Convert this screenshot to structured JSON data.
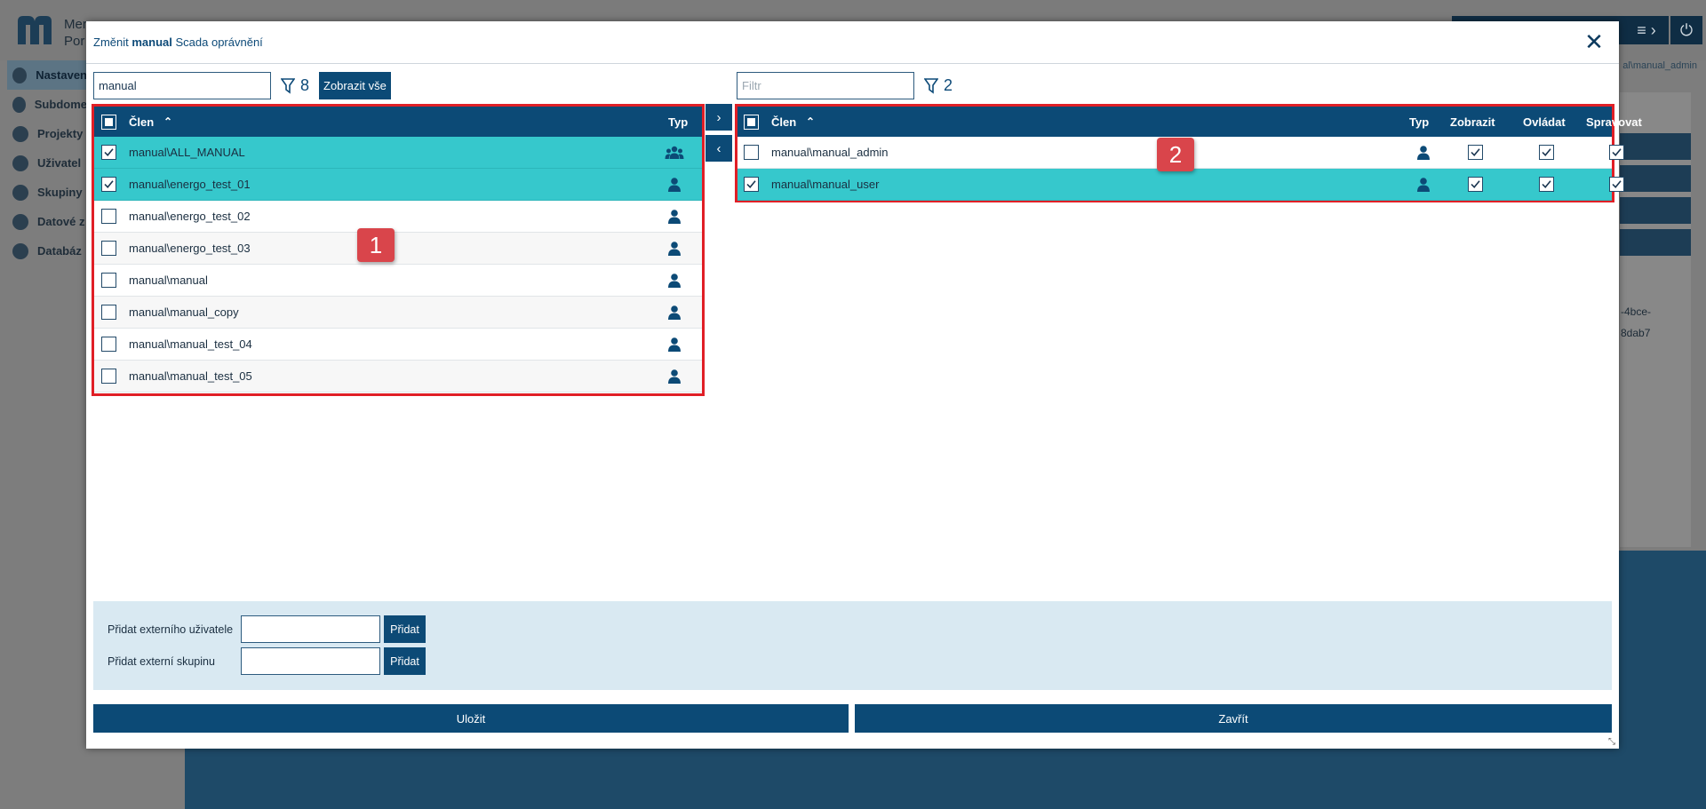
{
  "background": {
    "brand_line1": "Mer",
    "brand_line2": "Por",
    "user_label": "al\\manual_admin",
    "sidebar": [
      {
        "label": "Nastaven",
        "active": true
      },
      {
        "label": "Subdome"
      },
      {
        "label": "Projekty"
      },
      {
        "label": "Uživatel"
      },
      {
        "label": "Skupiny"
      },
      {
        "label": "Datové z"
      },
      {
        "label": "Databáz"
      }
    ],
    "snippet1": "-4bce-",
    "snippet2": "8dab7"
  },
  "dialog": {
    "title_prefix": "Změnit",
    "title_bold": "manual",
    "title_suffix": "Scada oprávnění",
    "close_label": "✕"
  },
  "left": {
    "search_value": "manual",
    "filter_count": "8",
    "show_all_label": "Zobrazit vše",
    "col_member": "Člen",
    "col_type": "Typ",
    "rows": [
      {
        "name": "manual\\ALL_MANUAL",
        "type": "group-icon",
        "checked": true
      },
      {
        "name": "manual\\energo_test_01",
        "type": "user-icon",
        "checked": true
      },
      {
        "name": "manual\\energo_test_02",
        "type": "user-icon",
        "checked": false
      },
      {
        "name": "manual\\energo_test_03",
        "type": "user-icon",
        "checked": false
      },
      {
        "name": "manual\\manual",
        "type": "user-icon",
        "checked": false
      },
      {
        "name": "manual\\manual_copy",
        "type": "user-icon",
        "checked": false
      },
      {
        "name": "manual\\manual_test_04",
        "type": "user-icon",
        "checked": false
      },
      {
        "name": "manual\\manual_test_05",
        "type": "user-icon",
        "checked": false
      }
    ],
    "badge": "1"
  },
  "right": {
    "search_placeholder": "Filtr",
    "filter_count": "2",
    "col_member": "Člen",
    "col_type": "Typ",
    "col_view": "Zobrazit",
    "col_control": "Ovládat",
    "col_manage": "Spravovat",
    "rows": [
      {
        "name": "manual\\manual_admin",
        "type": "user-icon",
        "checked": false,
        "view": true,
        "control": true,
        "manage": true
      },
      {
        "name": "manual\\manual_user",
        "type": "user-icon",
        "checked": true,
        "view": true,
        "control": true,
        "manage": true
      }
    ],
    "badge": "2"
  },
  "move": {
    "right_arrow": "›",
    "left_arrow": "‹"
  },
  "external": {
    "user_label": "Přidat externího uživatele",
    "group_label": "Přidat externí skupinu",
    "add_label": "Přidat"
  },
  "footer": {
    "save_label": "Uložit",
    "close_label": "Zavřít"
  },
  "colors": {
    "primary": "#0c4a76",
    "selected_row": "#36c8cc",
    "highlight_border": "#e01f26",
    "badge": "#d9454b"
  }
}
